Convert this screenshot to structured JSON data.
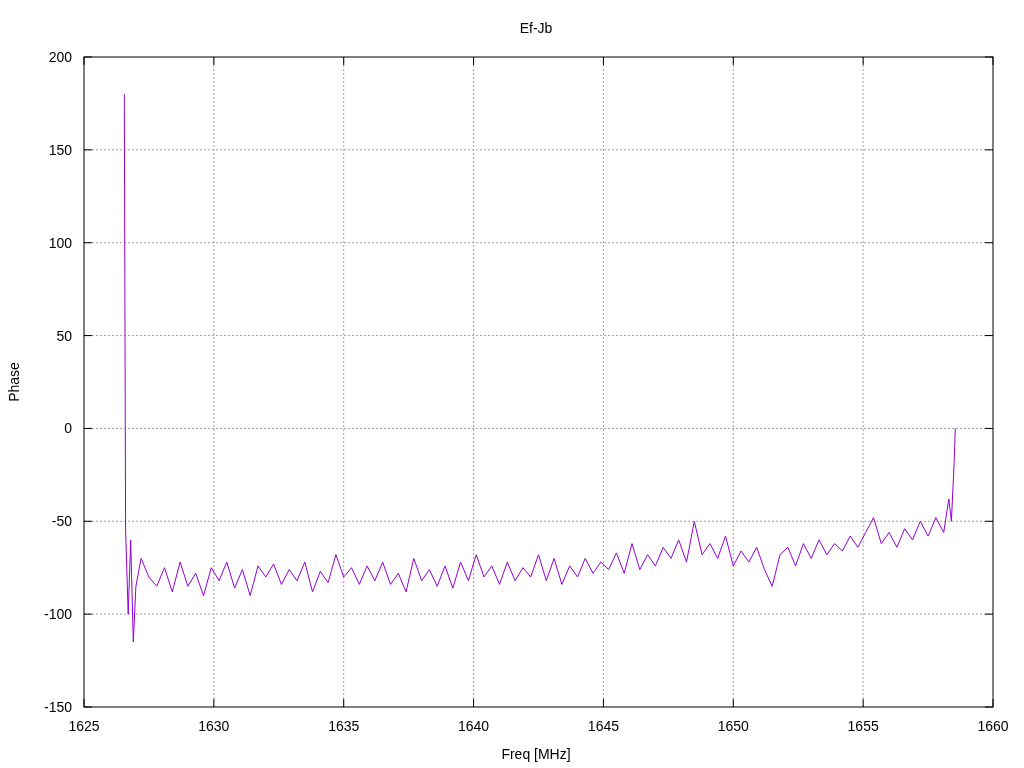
{
  "chart_data": {
    "type": "line",
    "title": "Ef-Jb",
    "xlabel": "Freq [MHz]",
    "ylabel": "Phase",
    "xlim": [
      1625,
      1660
    ],
    "ylim": [
      -150,
      200
    ],
    "xticks": [
      1625,
      1630,
      1635,
      1640,
      1645,
      1650,
      1655,
      1660
    ],
    "yticks": [
      -150,
      -100,
      -50,
      0,
      50,
      100,
      150,
      200
    ],
    "x": [
      1626.55,
      1626.6,
      1626.7,
      1626.8,
      1626.9,
      1627.0,
      1627.2,
      1627.5,
      1627.8,
      1628.1,
      1628.4,
      1628.7,
      1629.0,
      1629.3,
      1629.6,
      1629.9,
      1630.2,
      1630.5,
      1630.8,
      1631.1,
      1631.4,
      1631.7,
      1632.0,
      1632.3,
      1632.6,
      1632.9,
      1633.2,
      1633.5,
      1633.8,
      1634.1,
      1634.4,
      1634.7,
      1635.0,
      1635.3,
      1635.6,
      1635.9,
      1636.2,
      1636.5,
      1636.8,
      1637.1,
      1637.4,
      1637.7,
      1638.0,
      1638.3,
      1638.6,
      1638.9,
      1639.2,
      1639.5,
      1639.8,
      1640.1,
      1640.4,
      1640.7,
      1641.0,
      1641.3,
      1641.6,
      1641.9,
      1642.2,
      1642.5,
      1642.8,
      1643.1,
      1643.4,
      1643.7,
      1644.0,
      1644.3,
      1644.6,
      1644.9,
      1645.2,
      1645.5,
      1645.8,
      1646.1,
      1646.4,
      1646.7,
      1647.0,
      1647.3,
      1647.6,
      1647.9,
      1648.2,
      1648.5,
      1648.8,
      1649.1,
      1649.4,
      1649.7,
      1650.0,
      1650.3,
      1650.6,
      1650.9,
      1651.2,
      1651.5,
      1651.8,
      1652.1,
      1652.4,
      1652.7,
      1653.0,
      1653.3,
      1653.6,
      1653.9,
      1654.2,
      1654.5,
      1654.8,
      1655.1,
      1655.4,
      1655.7,
      1656.0,
      1656.3,
      1656.6,
      1656.9,
      1657.2,
      1657.5,
      1657.8,
      1658.1,
      1658.3,
      1658.4,
      1658.5,
      1658.55
    ],
    "grid": true,
    "series": [
      {
        "color": "#9400d3",
        "values": [
          180,
          -55,
          -100,
          -60,
          -115,
          -85,
          -70,
          -80,
          -85,
          -75,
          -88,
          -72,
          -85,
          -78,
          -90,
          -75,
          -82,
          -72,
          -86,
          -76,
          -90,
          -74,
          -80,
          -73,
          -84,
          -76,
          -82,
          -72,
          -88,
          -77,
          -83,
          -68,
          -80,
          -75,
          -84,
          -74,
          -82,
          -72,
          -84,
          -78,
          -88,
          -70,
          -82,
          -76,
          -85,
          -74,
          -86,
          -72,
          -82,
          -68,
          -80,
          -74,
          -84,
          -72,
          -82,
          -75,
          -80,
          -68,
          -82,
          -70,
          -84,
          -74,
          -80,
          -70,
          -78,
          -72,
          -76,
          -67,
          -78,
          -62,
          -76,
          -68,
          -74,
          -64,
          -70,
          -60,
          -72,
          -50,
          -68,
          -62,
          -70,
          -58,
          -74,
          -66,
          -72,
          -64,
          -76,
          -85,
          -68,
          -64,
          -74,
          -62,
          -70,
          -60,
          -68,
          -62,
          -66,
          -58,
          -64,
          -56,
          -48,
          -62,
          -56,
          -64,
          -54,
          -60,
          -50,
          -58,
          -48,
          -56,
          -38,
          -50,
          -20,
          0
        ]
      }
    ]
  }
}
